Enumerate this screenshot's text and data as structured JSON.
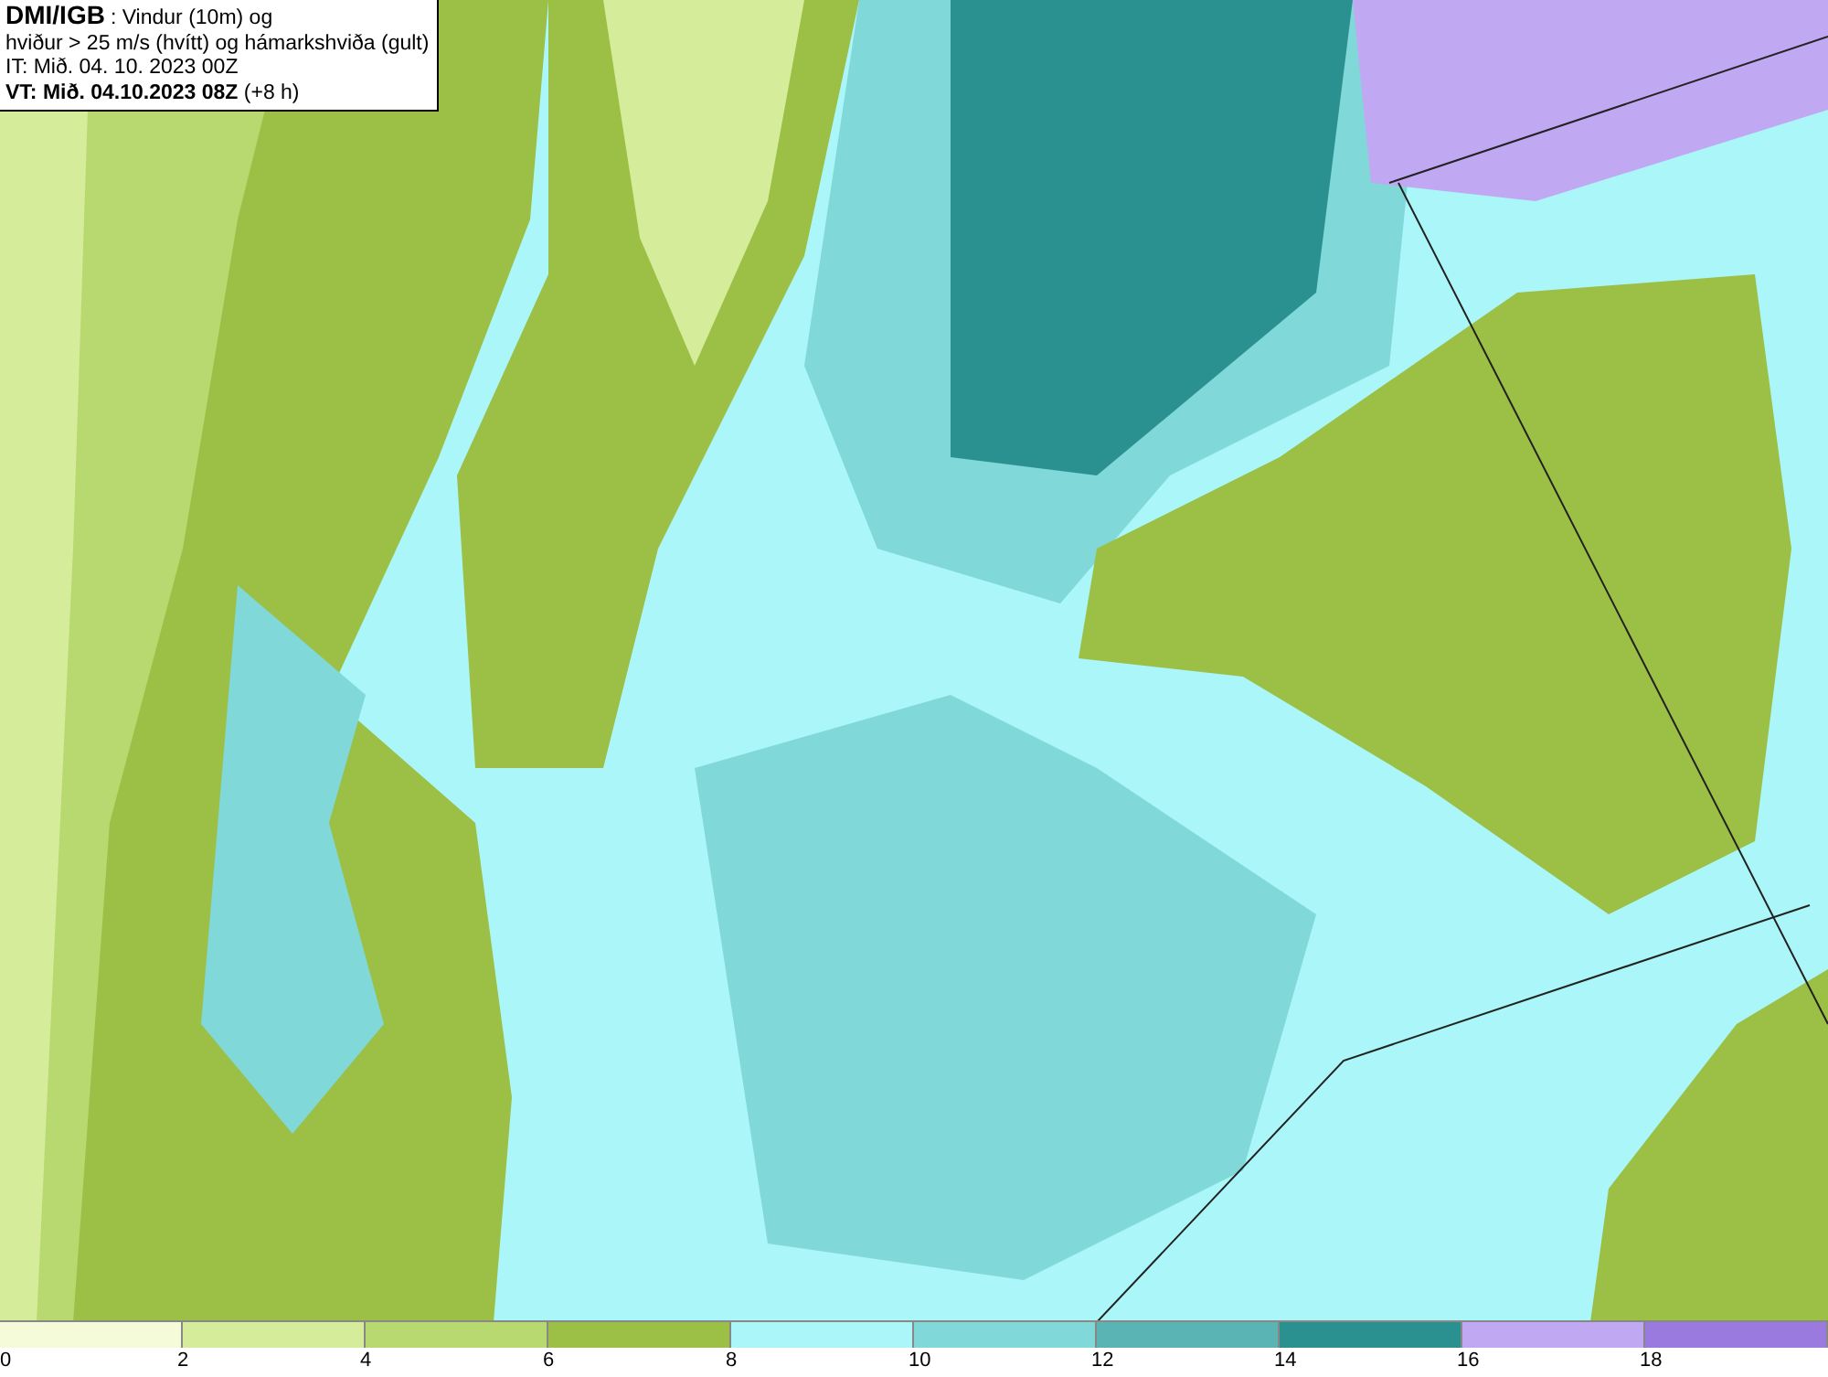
{
  "header": {
    "title": "DMI/IGB",
    "subtitle": ": Vindur (10m) og",
    "lines": [
      "hviður > 25 m/s (hvítt) og hámarkshviða (gult)",
      "IT: Mið. 04. 10. 2023 00Z",
      "**VT: Mið. 04.10.2023 08Z** (+8 h)"
    ]
  },
  "legend": [
    {
      "label": "0",
      "color": "#f5fbd8"
    },
    {
      "label": "2",
      "color": "#d5ec9b"
    },
    {
      "label": "4",
      "color": "#b8d870"
    },
    {
      "label": "6",
      "color": "#9cbf45"
    },
    {
      "label": "8",
      "color": "#aaf6f8"
    },
    {
      "label": "10",
      "color": "#80d8d8"
    },
    {
      "label": "12",
      "color": "#5ab4b4"
    },
    {
      "label": "14",
      "color": "#2a9090"
    },
    {
      "label": "16",
      "color": "#c0a8f2"
    },
    {
      "label": "18",
      "color": "#9a7ade"
    }
  ]
}
